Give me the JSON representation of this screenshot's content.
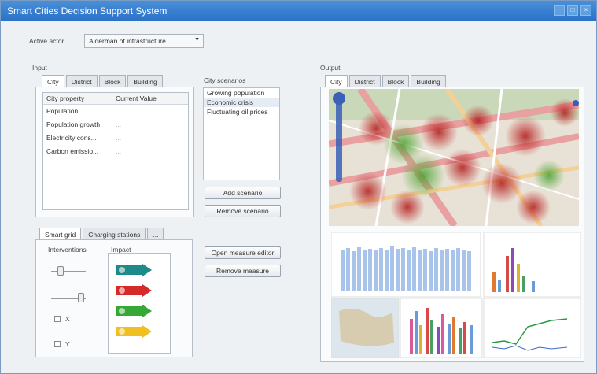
{
  "window": {
    "title": "Smart Cities Decision Support System"
  },
  "actor": {
    "label": "Active actor",
    "value": "Alderman of infrastructure"
  },
  "input": {
    "label": "Input",
    "tabs": [
      "City",
      "District",
      "Block",
      "Building"
    ],
    "table": {
      "headers": [
        "City property",
        "Current Value"
      ],
      "rows": [
        [
          "Population",
          "..."
        ],
        [
          "Population growth",
          "..."
        ],
        [
          "Electricity cons...",
          "..."
        ],
        [
          "Carbon emissio...",
          "..."
        ]
      ]
    }
  },
  "scenarios": {
    "label": "City scenarios",
    "items": [
      "Growing population",
      "Economic crisis",
      "Fluctuating oil prices"
    ],
    "selected_index": 1,
    "add_button": "Add scenario",
    "remove_button": "Remove scenario"
  },
  "measures": {
    "tabs": [
      "Smart grid",
      "Charging stations",
      "..."
    ],
    "interventions_label": "Interventions",
    "impact_label": "Impact",
    "checkbox_x": "X",
    "checkbox_y": "Y",
    "open_editor_button": "Open measure editor",
    "remove_button": "Remove measure"
  },
  "output": {
    "label": "Output",
    "tabs": [
      "City",
      "District",
      "Block",
      "Building"
    ]
  },
  "colors": {
    "titlebar": "#2a70c8",
    "impact_teal": "#1f8a8a",
    "impact_red": "#d42a2a",
    "impact_green": "#36a836",
    "impact_yellow": "#f0c020"
  }
}
